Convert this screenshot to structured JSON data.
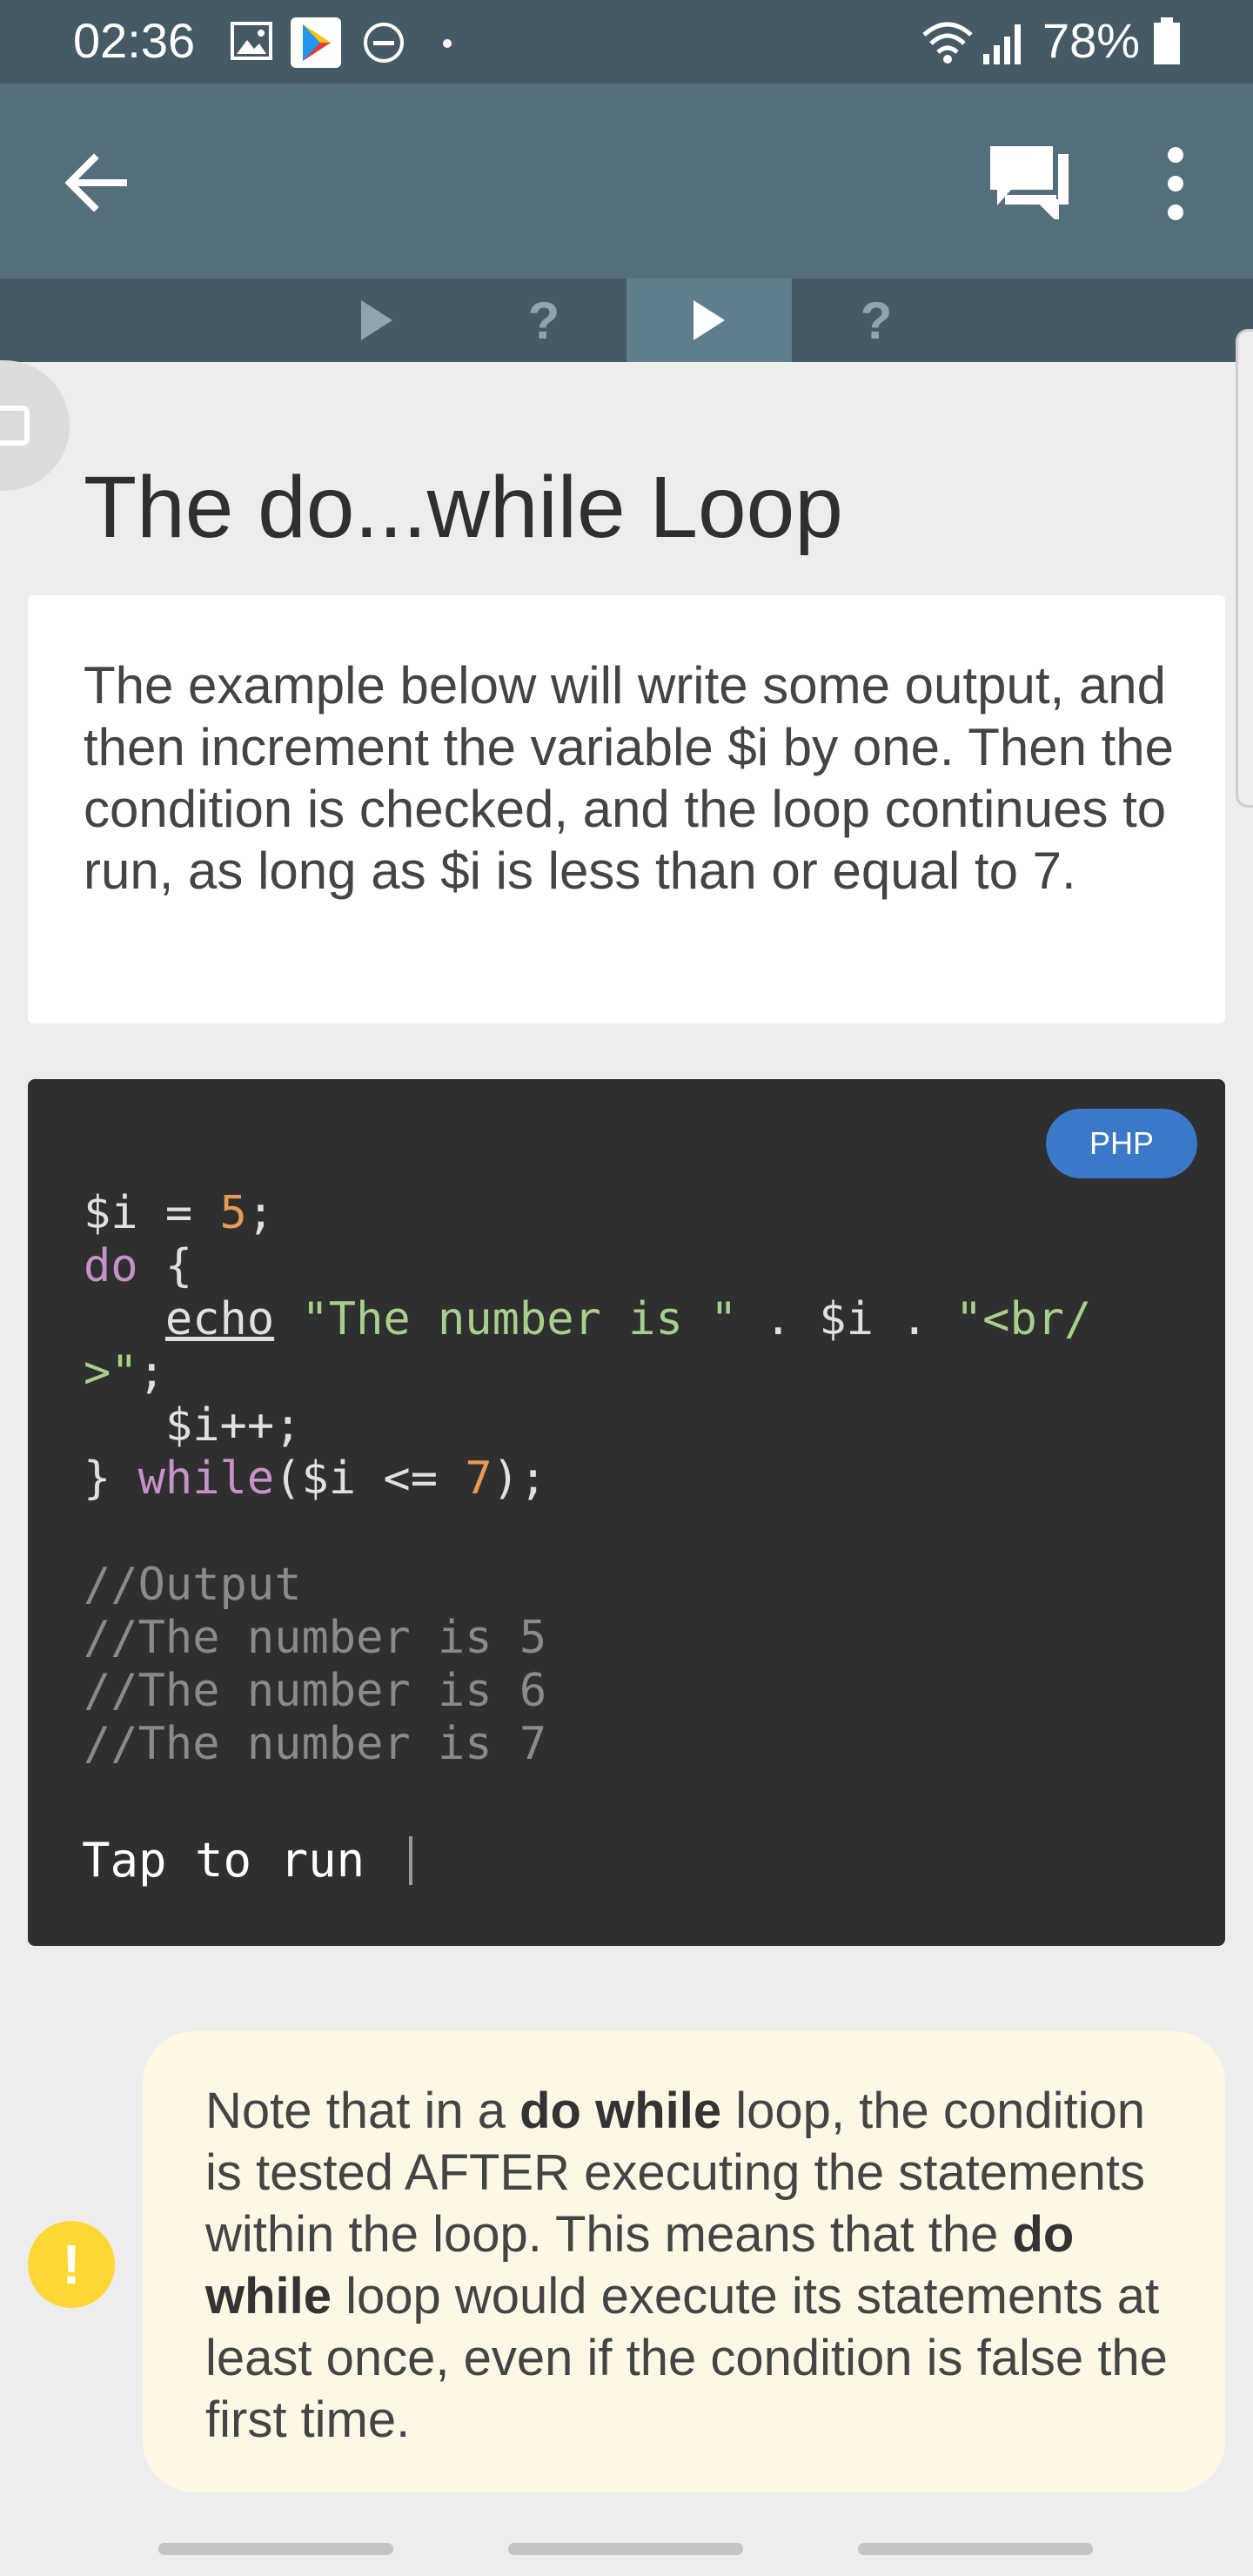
{
  "status": {
    "time": "02:36",
    "battery": "78%"
  },
  "tabs": [
    {
      "label": "▶"
    },
    {
      "label": "?"
    },
    {
      "label": "▶"
    },
    {
      "label": "?"
    }
  ],
  "page": {
    "title": "The do...while Loop",
    "description": "The example below will write some output, and then increment the variable $i by one. Then the condition is checked, and the loop continues to run, as long as $i is less than or equal to 7."
  },
  "code": {
    "language": "PHP",
    "run_hint": "Tap to run"
  },
  "note": {
    "part1": "Note that in a ",
    "bold1": "do while",
    "part2": " loop, the condition is tested AFTER executing the statements within the loop. This means that the ",
    "bold2": "do while",
    "part3": " loop would execute its statements at least once, even if the condition is false the first time.",
    "icon": "!"
  },
  "colors": {
    "app_bar": "#546e7a",
    "status_bar": "#455a64",
    "code_bg": "#2f2f2f",
    "badge": "#3a78c8",
    "note_bg": "#fdf8e5",
    "note_icon": "#fdd835"
  }
}
